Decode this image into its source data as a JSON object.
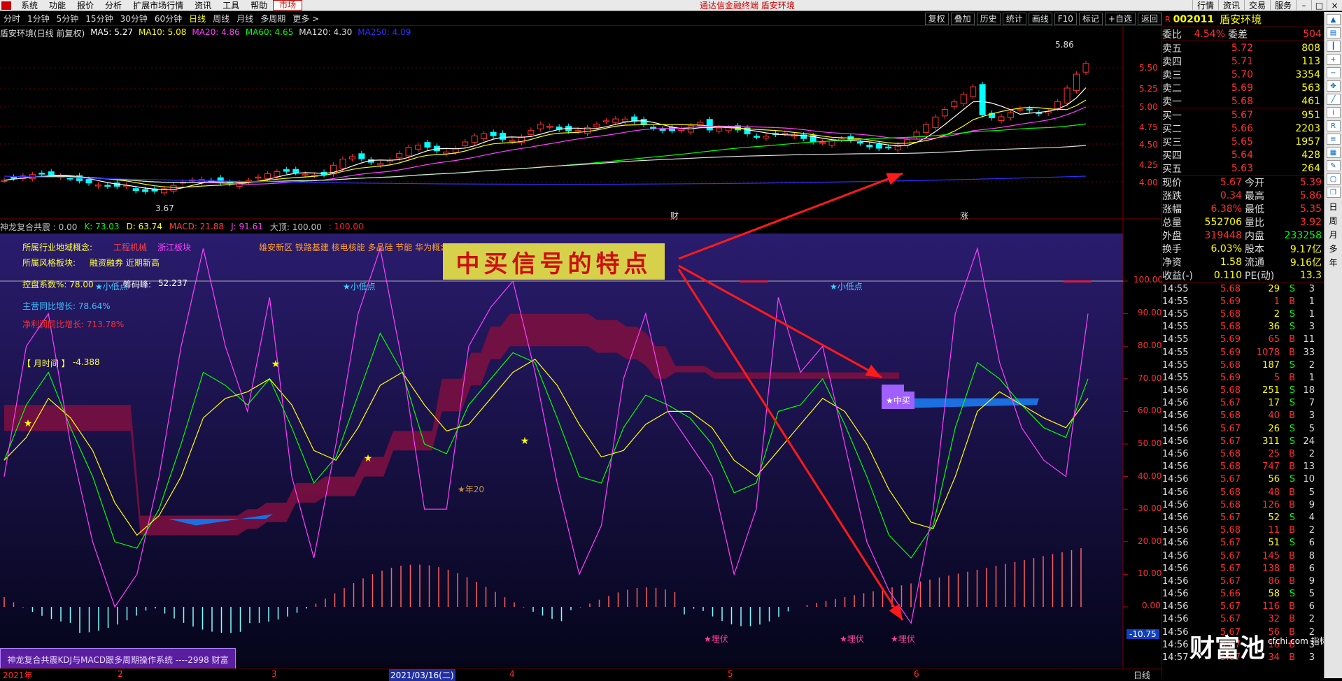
{
  "menubar": {
    "items": [
      "系统",
      "功能",
      "报价",
      "分析",
      "扩展市场行情",
      "资讯",
      "工具",
      "帮助"
    ],
    "active": "市场",
    "app_title": "通达信金融终端  盾安环境",
    "right_buttons": [
      "行情",
      "资讯",
      "交易",
      "服务"
    ]
  },
  "periods": [
    "分时",
    "1分钟",
    "5分钟",
    "15分钟",
    "30分钟",
    "60分钟",
    "日线",
    "周线",
    "月线",
    "多周期",
    "更多 >"
  ],
  "period_active": "日线",
  "toolbar_right": [
    "复权",
    "叠加",
    "历史",
    "统计",
    "画线",
    "F10",
    "标记",
    "+自选",
    "返回"
  ],
  "main_legend": {
    "title": "盾安环境(日线 前复权)",
    "ma": [
      {
        "label": "MA5: 5.27",
        "color": "#ffffff"
      },
      {
        "label": "MA10: 5.08",
        "color": "#ffff00"
      },
      {
        "label": "MA20: 4.86",
        "color": "#ff40ff"
      },
      {
        "label": "MA60: 4.65",
        "color": "#00ff00"
      },
      {
        "label": "MA120: 4.30",
        "color": "#dddddd"
      },
      {
        "label": "MA250: 4.09",
        "color": "#3030ff"
      }
    ]
  },
  "price_axis": [
    "5.50",
    "5.25",
    "5.00",
    "4.75",
    "4.50",
    "4.25",
    "4.00"
  ],
  "price_marks": {
    "high": "5.86",
    "low": "3.67"
  },
  "event_marks": [
    "财",
    "涨"
  ],
  "ind_legend": [
    {
      "label": "神龙复合共震 : 0.00",
      "color": "#c0c0c0"
    },
    {
      "label": "K: 73.03",
      "color": "#00ff00"
    },
    {
      "label": "D: 63.74",
      "color": "#ffff00"
    },
    {
      "label": "MACD: 21.88",
      "color": "#ff4040"
    },
    {
      "label": "J: 91.61",
      "color": "#ff40ff"
    },
    {
      "label": "大顶: 100.00",
      "color": "#c0c0c0"
    },
    {
      "label": ": 100.00",
      "color": "#ff2020"
    }
  ],
  "info_lines": {
    "industry_label": "所属行业地域概念:",
    "industry_tags": [
      "工程机械",
      "浙江板块"
    ],
    "concept_tags": "雄安新区 铁路基建 核电核能 多晶硅 节能 华为概念 转基因 新能源车 锂电池",
    "style_label": "所属风格板块:",
    "style_tags": "融资融券 近期新高",
    "control_label": "控盘系数%: 78.00",
    "chip_label": "筹码峰:",
    "chip_value": "52.237",
    "main_growth": "主营同比增长: 78.64%",
    "profit_growth": "净利润同比增长: 713.78%",
    "month_time": "【 月时间 】",
    "month_value": "-4.388"
  },
  "signals": {
    "small_low": "★小低点",
    "mid_buy": "★中买",
    "ambush": "★埋伏",
    "year20": "★年20"
  },
  "ind_axis": [
    "100.00",
    "90.00",
    "80.00",
    "70.00",
    "60.00",
    "50.00",
    "40.00",
    "30.00",
    "20.00",
    "10.00",
    "0.00"
  ],
  "ind_axis_neg": "-10.75",
  "annotation": "中买信号的特点",
  "promo": "神龙复合共震KDJ与MACD跟多周期操作系统 ----2998 财富",
  "dates": [
    "2021年",
    "2",
    "3",
    "2021/03/16(二)",
    "4",
    "5",
    "6",
    "日线"
  ],
  "stock": {
    "code": "002011",
    "name": "盾安环境",
    "weibi_label": "委比",
    "weibi": "4.54%",
    "weicha_label": "委差",
    "weicha": "504",
    "asks": [
      {
        "label": "卖五",
        "price": "5.72",
        "vol": "808"
      },
      {
        "label": "卖四",
        "price": "5.71",
        "vol": "113"
      },
      {
        "label": "卖三",
        "price": "5.70",
        "vol": "3354"
      },
      {
        "label": "卖二",
        "price": "5.69",
        "vol": "563"
      },
      {
        "label": "卖一",
        "price": "5.68",
        "vol": "461"
      }
    ],
    "bids": [
      {
        "label": "买一",
        "price": "5.67",
        "vol": "951"
      },
      {
        "label": "买二",
        "price": "5.66",
        "vol": "2203"
      },
      {
        "label": "买三",
        "price": "5.65",
        "vol": "1957"
      },
      {
        "label": "买四",
        "price": "5.64",
        "vol": "428"
      },
      {
        "label": "买五",
        "price": "5.63",
        "vol": "264"
      }
    ],
    "stats": [
      {
        "l1": "现价",
        "v1": "5.67",
        "c1": "#ff3030",
        "l2": "今开",
        "v2": "5.39",
        "c2": "#ff3030"
      },
      {
        "l1": "涨跌",
        "v1": "0.34",
        "c1": "#ff3030",
        "l2": "最高",
        "v2": "5.86",
        "c2": "#ff3030"
      },
      {
        "l1": "涨幅",
        "v1": "6.38%",
        "c1": "#ff3030",
        "l2": "最低",
        "v2": "5.35",
        "c2": "#ff3030"
      },
      {
        "l1": "总量",
        "v1": "552706",
        "c1": "#ffff00",
        "l2": "量比",
        "v2": "3.92",
        "c2": "#ff3030"
      },
      {
        "l1": "外盘",
        "v1": "319448",
        "c1": "#ff3030",
        "l2": "内盘",
        "v2": "233258",
        "c2": "#00ff00"
      },
      {
        "l1": "换手",
        "v1": "6.03%",
        "c1": "#ffff00",
        "l2": "股本",
        "v2": "9.17亿",
        "c2": "#ffff00"
      },
      {
        "l1": "净资",
        "v1": "1.58",
        "c1": "#ffff00",
        "l2": "流通",
        "v2": "9.16亿",
        "c2": "#ffff00"
      },
      {
        "l1": "收益(-)",
        "v1": "0.110",
        "c1": "#ffff00",
        "l2": "PE(动)",
        "v2": "13.3",
        "c2": "#ffff00"
      }
    ],
    "ticks": [
      [
        "14:55",
        "5.68",
        "29",
        "S",
        "3"
      ],
      [
        "14:55",
        "5.69",
        "1",
        "B",
        "1"
      ],
      [
        "14:55",
        "5.68",
        "2",
        "S",
        "1"
      ],
      [
        "14:55",
        "5.68",
        "36",
        "S",
        "3"
      ],
      [
        "14:55",
        "5.69",
        "65",
        "B",
        "11"
      ],
      [
        "14:55",
        "5.69",
        "1078",
        "B",
        "33"
      ],
      [
        "14:55",
        "5.68",
        "187",
        "S",
        "2"
      ],
      [
        "14:55",
        "5.69",
        "5",
        "B",
        "1"
      ],
      [
        "14:56",
        "5.68",
        "251",
        "S",
        "18"
      ],
      [
        "14:56",
        "5.67",
        "17",
        "S",
        "7"
      ],
      [
        "14:56",
        "5.68",
        "40",
        "B",
        "3"
      ],
      [
        "14:56",
        "5.67",
        "26",
        "S",
        "5"
      ],
      [
        "14:56",
        "5.67",
        "311",
        "S",
        "24"
      ],
      [
        "14:56",
        "5.68",
        "25",
        "B",
        "2"
      ],
      [
        "14:56",
        "5.68",
        "747",
        "B",
        "13"
      ],
      [
        "14:56",
        "5.67",
        "56",
        "S",
        "10"
      ],
      [
        "14:56",
        "5.68",
        "48",
        "B",
        "5"
      ],
      [
        "14:56",
        "5.68",
        "126",
        "B",
        "9"
      ],
      [
        "14:56",
        "5.67",
        "52",
        "S",
        "4"
      ],
      [
        "14:56",
        "5.68",
        "11",
        "B",
        "2"
      ],
      [
        "14:56",
        "5.67",
        "51",
        "S",
        "6"
      ],
      [
        "14:56",
        "5.67",
        "145",
        "B",
        "8"
      ],
      [
        "14:56",
        "5.67",
        "138",
        "B",
        "6"
      ],
      [
        "14:56",
        "5.67",
        "86",
        "B",
        "9"
      ],
      [
        "14:56",
        "5.66",
        "58",
        "S",
        "5"
      ],
      [
        "14:56",
        "5.67",
        "116",
        "B",
        "6"
      ],
      [
        "14:56",
        "5.67",
        "32",
        "B",
        "2"
      ],
      [
        "14:56",
        "5.67",
        "56",
        "B",
        "2"
      ],
      [
        "14:56",
        "5.67",
        "16",
        "B",
        "3"
      ],
      [
        "14:57",
        "5.67",
        "34",
        "B",
        "3"
      ]
    ]
  },
  "side_tools": [
    "日",
    "周",
    "月",
    "多",
    "年"
  ],
  "watermark": "财富池",
  "watermark_sub": "cfchi.com 指标交易平台"
}
